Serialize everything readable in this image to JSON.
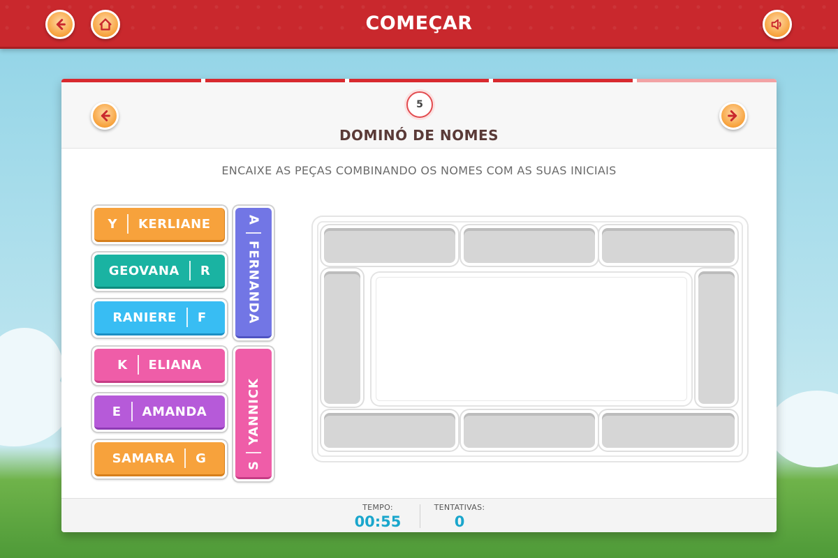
{
  "header": {
    "title": "COMEÇAR",
    "back_icon": "arrow-left-icon",
    "home_icon": "home-icon",
    "sound_icon": "speaker-icon"
  },
  "progress": {
    "total_steps": 5,
    "completed_steps": 4,
    "color": "#d82a2f"
  },
  "activity": {
    "step_number": "5",
    "title": "DOMINÓ DE NOMES",
    "instruction": "ENCAIXE AS PEÇAS COMBINANDO OS NOMES COM AS SUAS INICIAIS",
    "prev_icon": "arrow-left-icon",
    "next_icon": "arrow-right-icon"
  },
  "pieces_horizontal": [
    {
      "left": "Y",
      "right": "KERLIANE",
      "color": "orange"
    },
    {
      "left": "GEOVANA",
      "right": "R",
      "color": "teal"
    },
    {
      "left": "RANIERE",
      "right": "F",
      "color": "blue"
    },
    {
      "left": "K",
      "right": "ELIANA",
      "color": "pink"
    },
    {
      "left": "E",
      "right": "AMANDA",
      "color": "purple"
    },
    {
      "left": "SAMARA",
      "right": "G",
      "color": "orange"
    }
  ],
  "pieces_vertical": [
    {
      "top": "A",
      "bottom": "FERNANDA",
      "color": "violet"
    },
    {
      "top": "YANNICK",
      "bottom": "S",
      "color": "pink"
    }
  ],
  "footer": {
    "time_label": "TEMPO:",
    "time_value": "00:55",
    "attempts_label": "TENTATIVAS:",
    "attempts_value": "0"
  }
}
